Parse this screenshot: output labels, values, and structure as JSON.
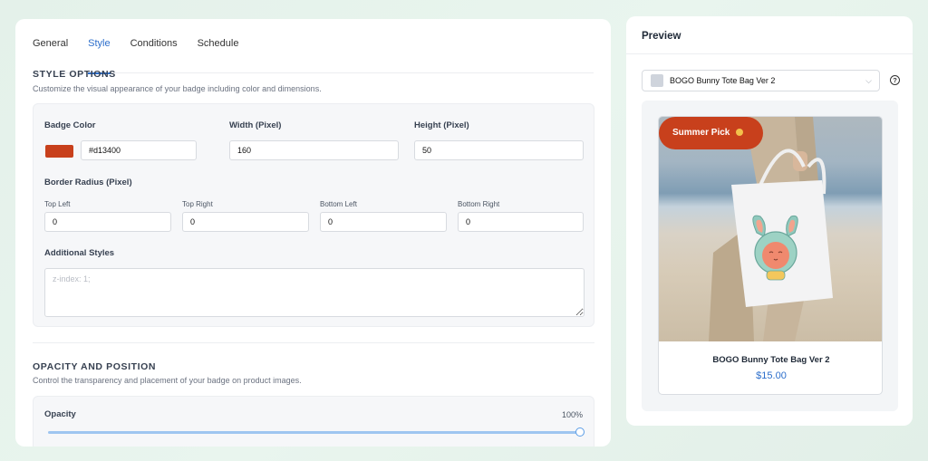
{
  "tabs": [
    {
      "label": "General",
      "active": false
    },
    {
      "label": "Style",
      "active": true
    },
    {
      "label": "Conditions",
      "active": false
    },
    {
      "label": "Schedule",
      "active": false
    }
  ],
  "style_options": {
    "title": "STYLE OPTIONS",
    "description": "Customize the visual appearance of your badge including color and dimensions.",
    "badge_color_label": "Badge Color",
    "badge_color_value": "#d13400",
    "width_label": "Width (Pixel)",
    "width_value": "160",
    "height_label": "Height (Pixel)",
    "height_value": "50",
    "border_radius_label": "Border Radius (Pixel)",
    "radius": {
      "top_left_label": "Top Left",
      "top_left_value": "0",
      "top_right_label": "Top Right",
      "top_right_value": "0",
      "bottom_left_label": "Bottom Left",
      "bottom_left_value": "0",
      "bottom_right_label": "Bottom Right",
      "bottom_right_value": "0"
    },
    "additional_styles_label": "Additional Styles",
    "additional_styles_placeholder": "z-index: 1;"
  },
  "opacity_position": {
    "title": "OPACITY AND POSITION",
    "description": "Control the transparency and placement of your badge on product images.",
    "opacity_label": "Opacity",
    "opacity_value_text": "100%",
    "opacity_fraction": 1.0
  },
  "preview": {
    "title": "Preview",
    "select_value": "BOGO Bunny Tote Bag Ver 2",
    "help_icon": "question-circle-icon",
    "badge_text": "Summer Pick",
    "badge_color": "#c8401c",
    "badge_emoji": "🟡",
    "product_name": "BOGO Bunny Tote Bag Ver 2",
    "product_price": "$15.00"
  },
  "colors": {
    "accent": "#2c6ecb",
    "swatch": "#c8401c"
  }
}
